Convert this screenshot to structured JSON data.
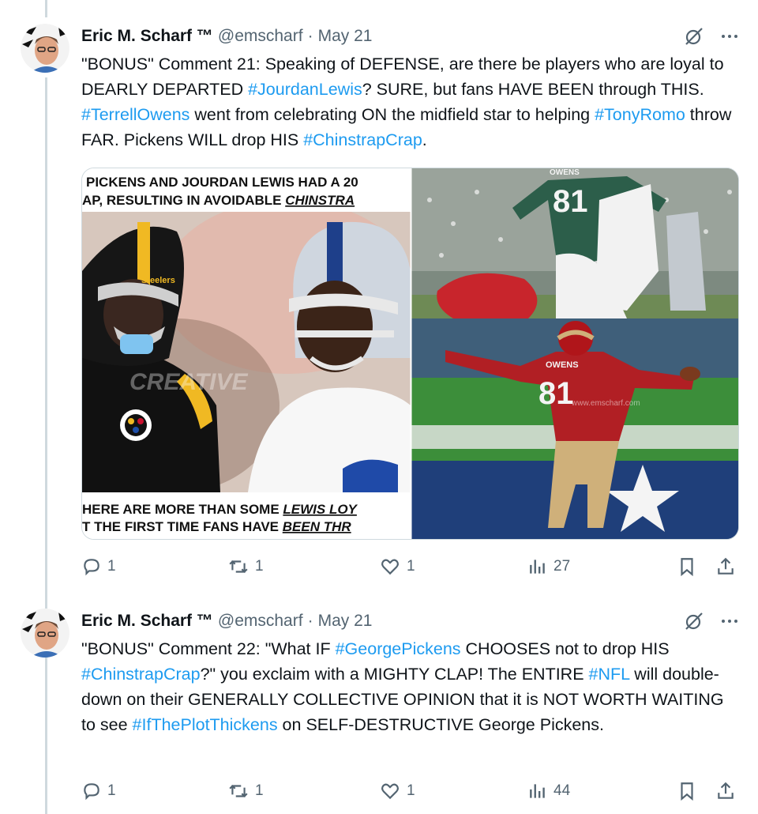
{
  "tweets": [
    {
      "author_name": "Eric M. Scharf ™",
      "handle": "@emscharf",
      "separator": "·",
      "date": "May 21",
      "text_parts": [
        {
          "t": "\"BONUS\" Comment 21: Speaking of DEFENSE, are there be players who are loyal to DEARLY DEPARTED ",
          "tag": false
        },
        {
          "t": "#JourdanLewis",
          "tag": true
        },
        {
          "t": "? SURE, but fans HAVE BEEN through THIS. ",
          "tag": false
        },
        {
          "t": "#TerrellOwens",
          "tag": true
        },
        {
          "t": " went from celebrating ON the midfield star to helping ",
          "tag": false
        },
        {
          "t": "#TonyRomo",
          "tag": true
        },
        {
          "t": " throw FAR. Pickens WILL drop HIS ",
          "tag": false
        },
        {
          "t": "#ChinstrapCrap",
          "tag": true
        },
        {
          "t": ".",
          "tag": false
        }
      ],
      "media": {
        "caption_top_line1": "PICKENS AND JOURDAN LEWIS HAD A 20",
        "caption_top_line2_a": "AP, RESULTING IN AVOIDABLE ",
        "caption_top_line2_b": "CHINSTRA",
        "caption_bottom_line1_a": "HERE ARE MORE THAN SOME ",
        "caption_bottom_line1_b": "LEWIS LOY",
        "caption_bottom_line2_a": "T THE FIRST TIME FANS HAVE ",
        "caption_bottom_line2_b": "BEEN THR",
        "jersey_number_top": "81",
        "jersey_name_top": "OWENS",
        "jersey_number_bottom": "81",
        "jersey_name_bottom": "OWENS",
        "helmet_word": "Steelers",
        "watermark": "CREATIVE",
        "watermark2": "www.emscharf.com"
      },
      "replies": "1",
      "reposts": "1",
      "likes": "1",
      "views": "27"
    },
    {
      "author_name": "Eric M. Scharf ™",
      "handle": "@emscharf",
      "separator": "·",
      "date": "May 21",
      "text_parts": [
        {
          "t": "\"BONUS\" Comment 22: \"What IF ",
          "tag": false
        },
        {
          "t": "#GeorgePickens",
          "tag": true
        },
        {
          "t": " CHOOSES not to drop HIS ",
          "tag": false
        },
        {
          "t": "#ChinstrapCrap",
          "tag": true
        },
        {
          "t": "?\" you exclaim with a MIGHTY CLAP! The ENTIRE ",
          "tag": false
        },
        {
          "t": "#NFL",
          "tag": true
        },
        {
          "t": " will double-down on their GENERALLY COLLECTIVE OPINION that it is NOT WORTH WAITING to see ",
          "tag": false
        },
        {
          "t": "#IfThePlotThickens",
          "tag": true
        },
        {
          "t": " on SELF-DESTRUCTIVE George Pickens.",
          "tag": false
        }
      ],
      "replies": "1",
      "reposts": "1",
      "likes": "1",
      "views": "44"
    }
  ],
  "colors": {
    "link": "#1d9bf0",
    "secondary": "#536471",
    "primary_text": "#0f1419",
    "thread_line": "#cfd9de"
  },
  "icons": [
    "grok-icon",
    "more-icon",
    "reply-icon",
    "repost-icon",
    "like-icon",
    "views-icon",
    "bookmark-icon",
    "share-icon"
  ]
}
